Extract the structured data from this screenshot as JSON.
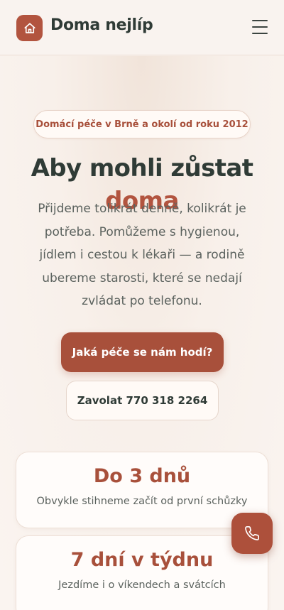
{
  "header": {
    "brand": "Doma nejlíp",
    "logo_icon": "house-icon",
    "menu_icon": "hamburger-menu-icon"
  },
  "hero": {
    "badge": "Domácí péče v Brně a okolí od roku 2012",
    "title_main": "Aby mohli zůstat ",
    "title_accent": "doma",
    "lead": "Přijdeme tolikrát denně, kolikrát je potřeba. Pomůžeme s hygienou, jídlem i cestou k lékaři — a rodině ubereme starosti, které se nedají zvládat po telefonu.",
    "cta_primary": "Jaká péče se nám hodí?",
    "cta_secondary": "Zavolat 770 318 2264"
  },
  "stats": [
    {
      "value": "Do 3 dnů",
      "label": "Obvykle stihneme začít od první schůzky"
    },
    {
      "value": "7 dní v týdnu",
      "label": "Jezdíme i o víkendech a svátcích"
    }
  ],
  "fab": {
    "icon": "phone-icon"
  },
  "colors": {
    "accent": "#a8503b",
    "text_dark": "#2f3b36",
    "background": "#f8efe9"
  }
}
